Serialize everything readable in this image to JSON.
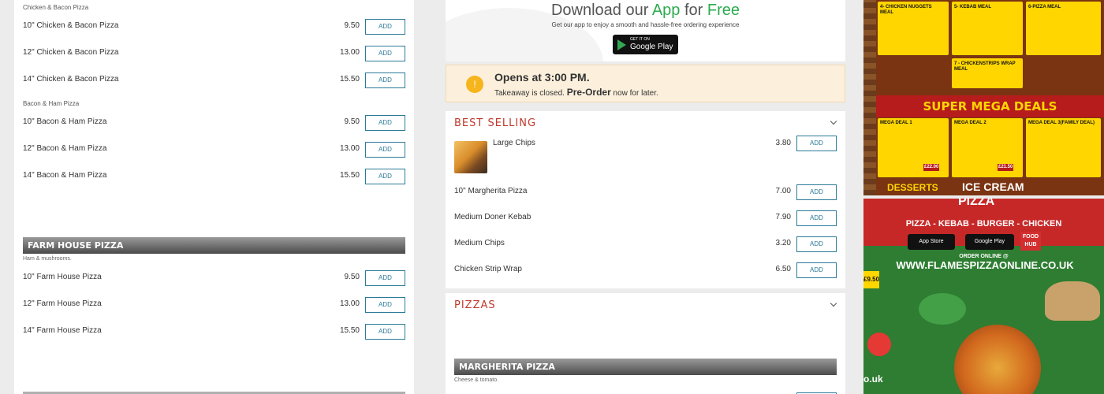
{
  "left_panel": {
    "groups": [
      {
        "subcategory": "Chicken & Bacon Pizza",
        "items": [
          {
            "name": "10\" Chicken & Bacon Pizza",
            "price": "9.50",
            "add": "ADD"
          },
          {
            "name": "12\" Chicken & Bacon Pizza",
            "price": "13.00",
            "add": "ADD"
          },
          {
            "name": "14\" Chicken & Bacon Pizza",
            "price": "15.50",
            "add": "ADD"
          }
        ]
      },
      {
        "subcategory": "Bacon & Ham Pizza",
        "items": [
          {
            "name": "10\" Bacon & Ham Pizza",
            "price": "9.50",
            "add": "ADD"
          },
          {
            "name": "12\" Bacon & Ham Pizza",
            "price": "13.00",
            "add": "ADD"
          },
          {
            "name": "14\" Bacon & Ham Pizza",
            "price": "15.50",
            "add": "ADD"
          }
        ]
      }
    ],
    "farm_house": {
      "title": "FARM HOUSE PIZZA",
      "description": "Ham & mushrooms.",
      "items": [
        {
          "name": "10\" Farm House Pizza",
          "price": "9.50",
          "add": "ADD"
        },
        {
          "name": "12\" Farm House Pizza",
          "price": "13.00",
          "add": "ADD"
        },
        {
          "name": "14\" Farm House Pizza",
          "price": "15.50",
          "add": "ADD"
        }
      ]
    }
  },
  "app_banner": {
    "title_prefix": "Download our",
    "title_app": "App",
    "title_mid": "for",
    "title_free": "Free",
    "subtitle": "Get our app to enjoy a smooth and hassle-free ordering experience",
    "gplay_small": "GET IT ON",
    "gplay_big": "Google Play",
    "accent_color": "#2bab4f"
  },
  "notice": {
    "icon": "!",
    "title": "Opens at 3:00 PM.",
    "text_before": "Takeaway is closed.",
    "pre_order": "Pre-Order",
    "text_after": "now for later."
  },
  "best_selling": {
    "title": "BEST SELLING",
    "items": [
      {
        "name": "Large Chips",
        "price": "3.80",
        "add": "ADD"
      },
      {
        "name": "10\" Margherita Pizza",
        "price": "7.00",
        "add": "ADD"
      },
      {
        "name": "Medium Doner Kebab",
        "price": "7.90",
        "add": "ADD"
      },
      {
        "name": "Medium Chips",
        "price": "3.20",
        "add": "ADD"
      },
      {
        "name": "Chicken Strip Wrap",
        "price": "6.50",
        "add": "ADD"
      }
    ]
  },
  "pizzas": {
    "title": "PIZZAS",
    "sub_title": "MARGHERITA PIZZA",
    "description": "Cheese & tomato."
  },
  "flyer_top": {
    "headline": "SUPER MEGA DEALS",
    "deals": [
      "MEGA DEAL 1",
      "MEGA DEAL 2",
      "MEGA DEAL 3(FAMILY DEAL)"
    ],
    "prices": [
      "£22.00",
      "£21.50"
    ],
    "meals": [
      "4- CHICKEN NUGGETS MEAL",
      "5- KEBAB MEAL",
      "6-PIZZA MEAL",
      "7 - CHICKENSTRIPS WRAP MEAL"
    ],
    "bottom_left": "DESSERTS",
    "bottom_right": "ICE CREAM"
  },
  "flyer_bottom": {
    "brand": "PIZZA",
    "tagline": "PIZZA - KEBAB - BURGER - CHICKEN",
    "app_store": "App Store",
    "google_play": "Google Play",
    "foodhub": "FOOD HUB",
    "order_online": "ORDER ONLINE @",
    "url": "WWW.FLAMESPIZZAONLINE.CO.UK",
    "price_tag": "£9.50",
    "footer_fragment": "o.uk"
  }
}
